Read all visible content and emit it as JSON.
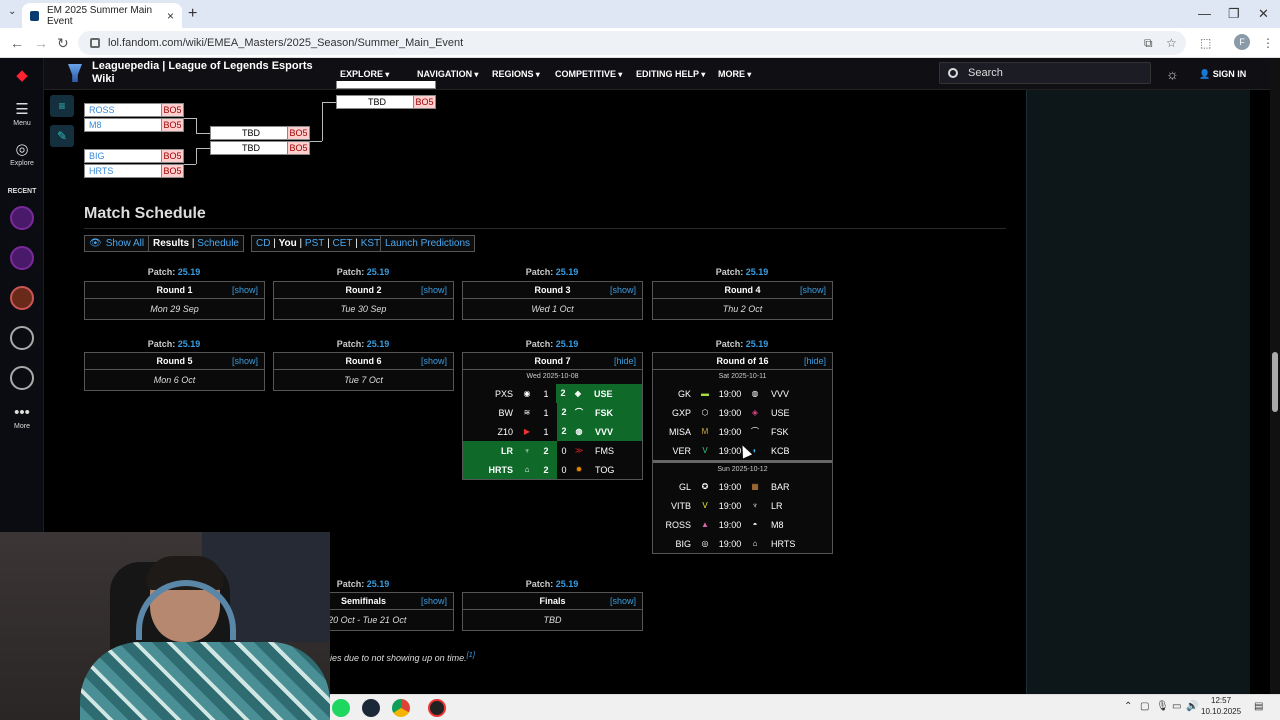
{
  "browser": {
    "tab_title": "EM 2025 Summer Main Event",
    "url": "lol.fandom.com/wiki/EMEA_Masters/2025_Season/Summer_Main_Event",
    "profile_initial": "F"
  },
  "site": {
    "title": "Leaguepedia | League of Legends Esports Wiki",
    "menu": [
      "EXPLORE",
      "NAVIGATION",
      "REGIONS",
      "COMPETITIVE",
      "EDITING HELP",
      "MORE"
    ],
    "search_placeholder": "Search",
    "sign_in": "SIGN IN"
  },
  "rail": {
    "menu": "Menu",
    "explore": "Explore",
    "recent": "RECENT",
    "more": "More"
  },
  "bracket": {
    "rows": [
      {
        "team": "ROSS",
        "bo": "BO5"
      },
      {
        "team": "M8",
        "bo": "BO5"
      },
      {
        "team": "BIG",
        "bo": "BO5"
      },
      {
        "team": "HRTS",
        "bo": "BO5"
      }
    ],
    "mid": [
      {
        "team": "TBD",
        "bo": "BO5"
      },
      {
        "team": "TBD",
        "bo": "BO5"
      }
    ],
    "top": [
      {
        "team": "TBD",
        "bo": "BO5"
      }
    ]
  },
  "schedule": {
    "heading": "Match Schedule",
    "show_all": "Show All",
    "results": "Results",
    "sched": "Schedule",
    "tz": [
      "CD",
      "You",
      "PST",
      "CET",
      "KST"
    ],
    "launch": "Launch Predictions",
    "patch_label": "Patch:",
    "patch": "25.19",
    "show": "[show]",
    "hide": "[hide]",
    "rounds": [
      {
        "name": "Round 1",
        "date": "Mon 29 Sep"
      },
      {
        "name": "Round 2",
        "date": "Tue 30 Sep"
      },
      {
        "name": "Round 3",
        "date": "Wed 1 Oct"
      },
      {
        "name": "Round 4",
        "date": "Thu 2 Oct"
      },
      {
        "name": "Round 5",
        "date": "Mon 6 Oct"
      },
      {
        "name": "Round 6",
        "date": "Tue 7 Oct"
      }
    ],
    "round7": {
      "name": "Round 7",
      "day": "Wed 2025-10-08",
      "matches": [
        {
          "t1": "PXS",
          "s1": "1",
          "s2": "2",
          "t2": "USE"
        },
        {
          "t1": "BW",
          "s1": "1",
          "s2": "2",
          "t2": "FSK"
        },
        {
          "t1": "Z10",
          "s1": "1",
          "s2": "2",
          "t2": "VVV"
        },
        {
          "t1": "LR",
          "s1": "2",
          "s2": "0",
          "t2": "FMS"
        },
        {
          "t1": "HRTS",
          "s1": "2",
          "s2": "0",
          "t2": "TOG"
        }
      ]
    },
    "r16": {
      "name": "Round of 16",
      "day1": "Sat 2025-10-11",
      "day2": "Sun 2025-10-12",
      "m1": [
        {
          "t1": "GK",
          "time": "19:00",
          "t2": "VVV"
        },
        {
          "t1": "GXP",
          "time": "19:00",
          "t2": "USE"
        },
        {
          "t1": "MISA",
          "time": "19:00",
          "t2": "FSK"
        },
        {
          "t1": "VER",
          "time": "19:00",
          "t2": "KCB"
        }
      ],
      "m2": [
        {
          "t1": "GL",
          "time": "19:00",
          "t2": "BAR"
        },
        {
          "t1": "VITB",
          "time": "19:00",
          "t2": "LR"
        },
        {
          "t1": "ROSS",
          "time": "19:00",
          "t2": "M8"
        },
        {
          "t1": "BIG",
          "time": "19:00",
          "t2": "HRTS"
        }
      ]
    },
    "semis": {
      "name": "Semifinals",
      "date": "n 20 Oct - Tue 21 Oct"
    },
    "finals": {
      "name": "Finals",
      "date": "TBD"
    },
    "footnote": "ies due to not showing up on time.",
    "footnote_ref": "[1]"
  },
  "clock": {
    "time": "12:57",
    "date": "10.10.2025"
  }
}
